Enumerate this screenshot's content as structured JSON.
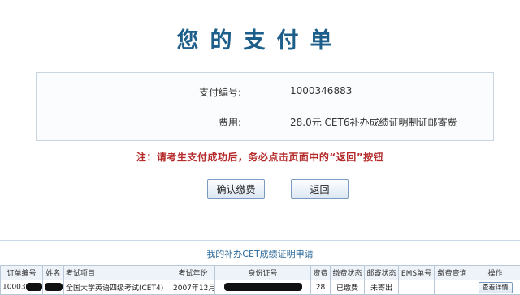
{
  "header": {
    "title": "您的支付单"
  },
  "payment": {
    "number_label": "支付编号:",
    "number_value": "1000346883",
    "fee_label": "费用:",
    "fee_value": "28.0元 CET6补办成绩证明制证邮寄费"
  },
  "notice": "注：请考生支付成功后，务必点击页面中的“返回”按钮",
  "buttons": {
    "confirm_label": "确认缴费",
    "back_label": "返回"
  },
  "table": {
    "title": "我的补办CET成绩证明申请",
    "headers": [
      "订单编号",
      "姓名",
      "考试项目",
      "考试年份",
      "身份证号",
      "资费",
      "缴费状态",
      "邮寄状态",
      "EMS单号",
      "缴费查询",
      "操作"
    ],
    "row": {
      "order_prefix": "10003",
      "exam": "全国大学英语四级考试(CET4)",
      "year": "2007年12月",
      "fee": "28",
      "pay_status": "已缴费",
      "mail_status": "未寄出",
      "ems": "",
      "query": "",
      "action_label": "查看详情"
    }
  },
  "colors": {
    "title": "#1d5f8a",
    "notice": "#b52a2a",
    "paid": "#2e8b2e",
    "unmailed": "#c62828"
  }
}
